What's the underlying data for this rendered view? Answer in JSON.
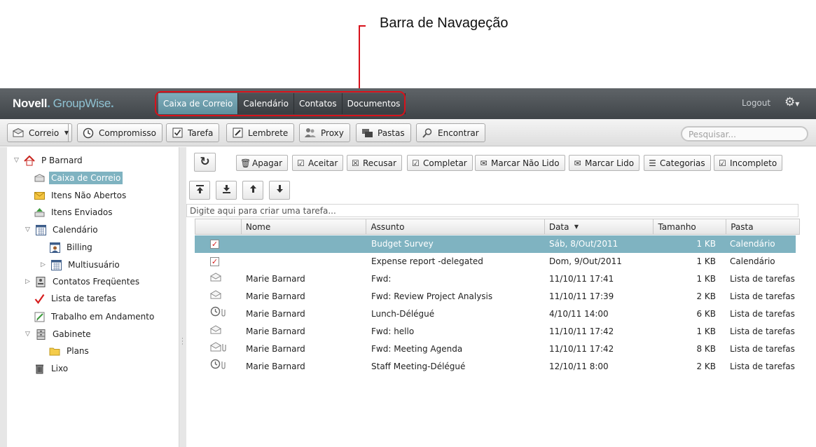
{
  "annotation": {
    "label": "Barra de Navageção",
    "color": "#d8121b"
  },
  "header": {
    "logo_brand": "Novell",
    "logo_dot": ".",
    "logo_product": "GroupWise",
    "logo_dot2": ".",
    "nav_tabs": [
      {
        "label": "Caixa de Correio",
        "active": true
      },
      {
        "label": "Calendário"
      },
      {
        "label": "Contatos"
      },
      {
        "label": "Documentos"
      }
    ],
    "logout": "Logout",
    "settings_icon": "gear-icon",
    "accent_color": "#7eaebc"
  },
  "toolbar": {
    "buttons": [
      {
        "label": "Correio",
        "icon": "mail-icon"
      },
      {
        "label": "Compromisso",
        "icon": "clock-icon"
      },
      {
        "label": "Tarefa",
        "icon": "checkbox-icon"
      },
      {
        "label": "Lembrete",
        "icon": "note-icon"
      },
      {
        "label": "Proxy",
        "icon": "users-icon"
      },
      {
        "label": "Pastas",
        "icon": "folders-icon"
      },
      {
        "label": "Encontrar",
        "icon": "find-icon"
      }
    ],
    "search_placeholder": "Pesquisar..."
  },
  "sidebar": {
    "items": [
      {
        "label": "P Barnard",
        "icon": "home-icon"
      },
      {
        "label": "Caixa de Correio",
        "icon": "mailbox-icon",
        "selected": true
      },
      {
        "label": "Itens Não Abertos",
        "icon": "envelope-icon"
      },
      {
        "label": "Itens Enviados",
        "icon": "sent-icon"
      },
      {
        "label": "Calendário",
        "icon": "calendar-icon"
      },
      {
        "label": "Billing",
        "icon": "shared-calendar-icon"
      },
      {
        "label": "Multiusuário",
        "icon": "calendar-icon"
      },
      {
        "label": "Contatos Freqüentes",
        "icon": "address-book-icon"
      },
      {
        "label": "Lista de tarefas",
        "icon": "checkmark-icon"
      },
      {
        "label": "Trabalho em Andamento",
        "icon": "draft-icon"
      },
      {
        "label": "Gabinete",
        "icon": "cabinet-icon"
      },
      {
        "label": "Plans",
        "icon": "folder-icon"
      },
      {
        "label": "Lixo",
        "icon": "trash-icon"
      }
    ],
    "selected_color": "#7fb3c1"
  },
  "actions": {
    "refresh_icon": "refresh-icon",
    "buttons": [
      {
        "label": "Apagar",
        "icon": "trash-icon"
      },
      {
        "label": "Aceitar",
        "icon": "checkbox-icon"
      },
      {
        "label": "Recusar",
        "icon": "decline-icon"
      },
      {
        "label": "Completar",
        "icon": "checkbox-icon"
      },
      {
        "label": "Marcar Não Lido",
        "icon": "envelope-closed-icon"
      },
      {
        "label": "Marcar Lido",
        "icon": "envelope-open-icon"
      },
      {
        "label": "Categorias",
        "icon": "list-icon"
      },
      {
        "label": "Incompleto",
        "icon": "checkbox-icon"
      }
    ],
    "move_buttons": [
      "move-top-icon",
      "move-bottom-icon",
      "move-up-icon",
      "move-down-icon"
    ],
    "new_task_placeholder": "Digite aqui para criar uma tarefa..."
  },
  "table": {
    "columns": [
      "",
      "Nome",
      "Assunto",
      "Data",
      "Tamanho",
      "Pasta"
    ],
    "sorted_column": "Data",
    "rows": [
      {
        "icon": "task-checked-icon",
        "nome": "",
        "assunto": "Budget Survey",
        "data": "Sáb, 8/Out/2011",
        "tamanho": "1 KB",
        "pasta": "Calendário",
        "selected": true
      },
      {
        "icon": "task-checked-icon",
        "nome": "",
        "assunto": "Expense report -delegated",
        "data": "Dom, 9/Out/2011",
        "tamanho": "1 KB",
        "pasta": "Calendário"
      },
      {
        "icon": "envelope-open-icon",
        "nome": "Marie Barnard",
        "assunto": "Fwd:",
        "data": "11/10/11 17:41",
        "tamanho": "1 KB",
        "pasta": "Lista de tarefas"
      },
      {
        "icon": "envelope-open-icon",
        "nome": "Marie Barnard",
        "assunto": "Fwd: Review Project Analysis",
        "data": "11/10/11 17:39",
        "tamanho": "2 KB",
        "pasta": "Lista de tarefas"
      },
      {
        "icon": "appointment-attachment-icon",
        "nome": "Marie Barnard",
        "assunto": "Lunch-Délégué",
        "data": "4/10/11 14:00",
        "tamanho": "6 KB",
        "pasta": "Lista de tarefas"
      },
      {
        "icon": "envelope-open-icon",
        "nome": "Marie Barnard",
        "assunto": "Fwd: hello",
        "data": "11/10/11 17:42",
        "tamanho": "1 KB",
        "pasta": "Lista de tarefas"
      },
      {
        "icon": "envelope-attachment-icon",
        "nome": "Marie Barnard",
        "assunto": "Fwd: Meeting Agenda",
        "data": "11/10/11 17:42",
        "tamanho": "8 KB",
        "pasta": "Lista de tarefas"
      },
      {
        "icon": "appointment-attachment-icon",
        "nome": "Marie Barnard",
        "assunto": "Staff Meeting-Délégué",
        "data": "12/10/11 8:00",
        "tamanho": "2 KB",
        "pasta": "Lista de tarefas"
      }
    ]
  }
}
